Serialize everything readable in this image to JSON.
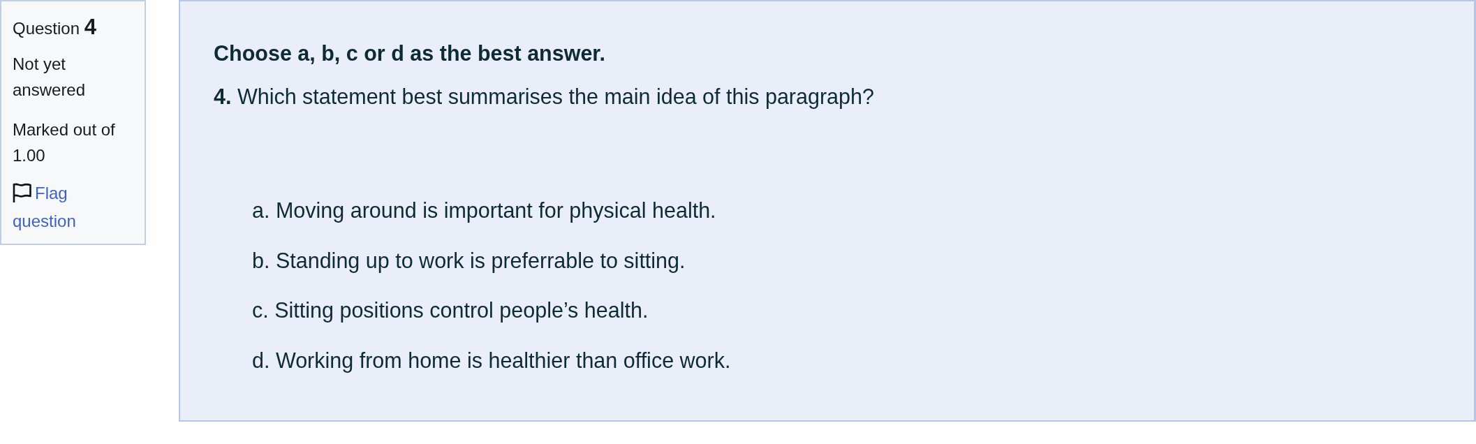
{
  "info": {
    "label": "Question",
    "number": "4",
    "status": "Not yet answered",
    "grade": "Marked out of 1.00",
    "flag_link": "Flag question"
  },
  "question": {
    "instruction": "Choose a, b, c or d as the best answer.",
    "text": "**4.** Which statement best summarises the main idea of this paragraph?",
    "options": [
      "a. Moving around is important for physical health.",
      "b. Standing up to work is preferrable to sitting.",
      "c. Sitting positions control people’s health.",
      "d. Working from home is healthier than office work."
    ]
  }
}
